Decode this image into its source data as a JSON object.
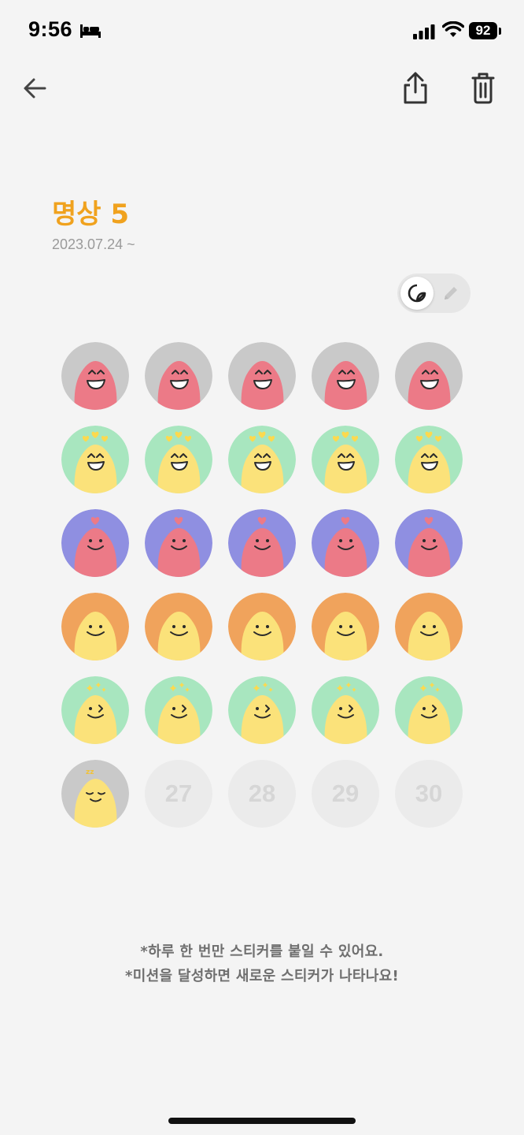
{
  "status_bar": {
    "time": "9:56",
    "battery": "92"
  },
  "header": {
    "title": "명상 5",
    "start_date": "2023.07.24 ~"
  },
  "toggle": {
    "active_mode": "sticker"
  },
  "stickers": [
    {
      "day": 1,
      "type": "grin",
      "bg": "#c9c9c9",
      "body": "#ec7a87"
    },
    {
      "day": 2,
      "type": "grin",
      "bg": "#c9c9c9",
      "body": "#ec7a87"
    },
    {
      "day": 3,
      "type": "grin",
      "bg": "#c9c9c9",
      "body": "#ec7a87"
    },
    {
      "day": 4,
      "type": "grin",
      "bg": "#c9c9c9",
      "body": "#ec7a87"
    },
    {
      "day": 5,
      "type": "grin",
      "bg": "#c9c9c9",
      "body": "#ec7a87"
    },
    {
      "day": 6,
      "type": "hearts-yellow",
      "bg": "#a8e6bf",
      "body": "#fbe27a"
    },
    {
      "day": 7,
      "type": "hearts-yellow",
      "bg": "#a8e6bf",
      "body": "#fbe27a"
    },
    {
      "day": 8,
      "type": "hearts-yellow",
      "bg": "#a8e6bf",
      "body": "#fbe27a"
    },
    {
      "day": 9,
      "type": "hearts-yellow",
      "bg": "#a8e6bf",
      "body": "#fbe27a"
    },
    {
      "day": 10,
      "type": "hearts-yellow",
      "bg": "#a8e6bf",
      "body": "#fbe27a"
    },
    {
      "day": 11,
      "type": "heart-pink",
      "bg": "#8f8fe1",
      "body": "#ec7a87"
    },
    {
      "day": 12,
      "type": "heart-pink",
      "bg": "#8f8fe1",
      "body": "#ec7a87"
    },
    {
      "day": 13,
      "type": "heart-pink",
      "bg": "#8f8fe1",
      "body": "#ec7a87"
    },
    {
      "day": 14,
      "type": "heart-pink",
      "bg": "#8f8fe1",
      "body": "#ec7a87"
    },
    {
      "day": 15,
      "type": "heart-pink",
      "bg": "#8f8fe1",
      "body": "#ec7a87"
    },
    {
      "day": 16,
      "type": "smile",
      "bg": "#f0a35c",
      "body": "#fbe27a"
    },
    {
      "day": 17,
      "type": "smile",
      "bg": "#f0a35c",
      "body": "#fbe27a"
    },
    {
      "day": 18,
      "type": "smile",
      "bg": "#f0a35c",
      "body": "#fbe27a"
    },
    {
      "day": 19,
      "type": "smile",
      "bg": "#f0a35c",
      "body": "#fbe27a"
    },
    {
      "day": 20,
      "type": "smile",
      "bg": "#f0a35c",
      "body": "#fbe27a"
    },
    {
      "day": 21,
      "type": "wink-sparkle",
      "bg": "#a8e6bf",
      "body": "#fbe27a"
    },
    {
      "day": 22,
      "type": "wink-sparkle",
      "bg": "#a8e6bf",
      "body": "#fbe27a"
    },
    {
      "day": 23,
      "type": "wink-sparkle",
      "bg": "#a8e6bf",
      "body": "#fbe27a"
    },
    {
      "day": 24,
      "type": "wink-sparkle",
      "bg": "#a8e6bf",
      "body": "#fbe27a"
    },
    {
      "day": 25,
      "type": "wink-sparkle",
      "bg": "#a8e6bf",
      "body": "#fbe27a"
    },
    {
      "day": 26,
      "type": "sleepy",
      "bg": "#c9c9c9",
      "body": "#fbe27a"
    },
    {
      "day": 27,
      "type": "empty",
      "label": "27"
    },
    {
      "day": 28,
      "type": "empty",
      "label": "28"
    },
    {
      "day": 29,
      "type": "empty",
      "label": "29"
    },
    {
      "day": 30,
      "type": "empty",
      "label": "30"
    }
  ],
  "notes": [
    "*하루 한 번만 스티커를 붙일 수 있어요.",
    "*미션을 달성하면 새로운 스티커가 나타나요!"
  ]
}
